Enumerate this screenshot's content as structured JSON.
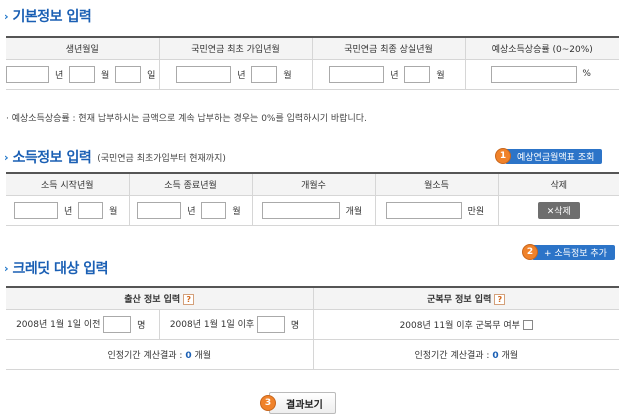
{
  "basic": {
    "title": "기본정보 입력",
    "headers": [
      "생년월일",
      "국민연금 최초 가입년월",
      "국민연금 최종 상실년월",
      "예상소득상승률 (0~20%)"
    ],
    "unit_year": "년",
    "unit_month": "월",
    "unit_day": "일",
    "unit_percent": "%"
  },
  "note": "· 예상소득상승률 : 현재 납부하시는 금액으로 계속 납부하는 경우는 0%를 입력하시기 바랍니다.",
  "income": {
    "title": "소득정보 입력",
    "subtitle": "(국민연금 최초가입부터 현재까지)",
    "btn_num": "1",
    "btn_label": "예상연금월액표 조회",
    "headers": [
      "소득 시작년월",
      "소득 종료년월",
      "개월수",
      "월소득",
      "삭제"
    ],
    "unit_year": "년",
    "unit_month": "월",
    "unit_count": "개월",
    "unit_money": "만원",
    "delete_label": "✕삭제",
    "add_num": "2",
    "add_label": "+ 소득정보 추가"
  },
  "credit": {
    "title": "크레딧 대상 입력",
    "birth_header": "출산 정보 입력",
    "military_header": "군복무 정보 입력",
    "help": "?",
    "before_label": "2008년 1월 1일 이전",
    "after_label": "2008년 1월 1일 이후",
    "unit_person": "명",
    "military_label": "2008년 11월 이후 군복무 여부",
    "result_prefix": "인정기간 계산결과 : ",
    "birth_result": "0",
    "military_result": "0",
    "result_unit": " 개월"
  },
  "result": {
    "num": "3",
    "label": "결과보기"
  }
}
